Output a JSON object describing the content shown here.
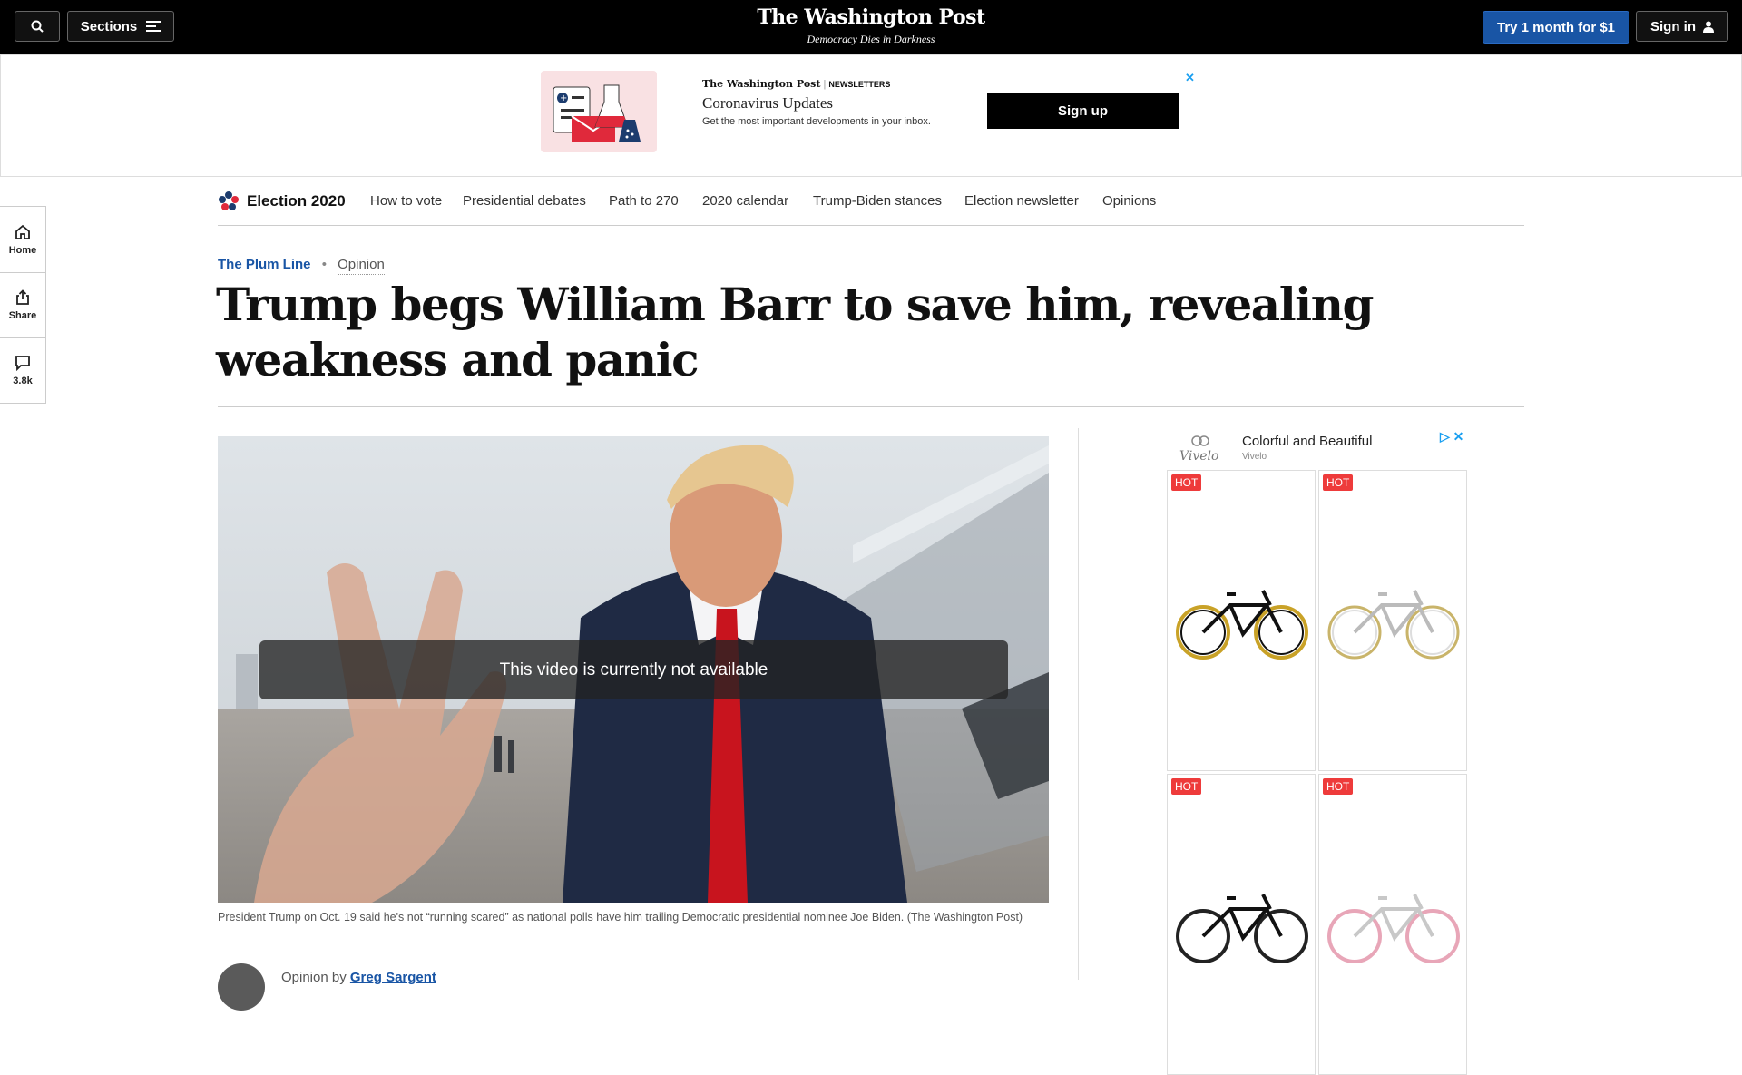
{
  "header": {
    "sections_label": "Sections",
    "logo": "The Washington Post",
    "tagline": "Democracy Dies in Darkness",
    "try_label": "Try 1 month for $1",
    "signin_label": "Sign in"
  },
  "newsletter_ad": {
    "brand": "The Washington Post",
    "brand_suffix": "NEWSLETTERS",
    "title": "Coronavirus Updates",
    "description": "Get the most important developments in your inbox.",
    "cta": "Sign up",
    "close": "✕"
  },
  "election_nav": {
    "title": "Election 2020",
    "items": [
      "How to vote",
      "Presidential debates",
      "Path to 270",
      "2020 calendar",
      "Trump-Biden stances",
      "Election newsletter",
      "Opinions"
    ]
  },
  "rail": {
    "home": "Home",
    "share": "Share",
    "comments": "3.8k"
  },
  "article": {
    "section": "The Plum Line",
    "label": "Opinion",
    "headline": "Trump begs William Barr to save him, revealing weakness and panic",
    "video_message": "This video is currently not available",
    "caption": "President Trump on Oct. 19 said he's not “running scared” as national polls have him trailing Democratic presidential nominee Joe Biden. (The Washington Post)",
    "byline_prefix": "Opinion by",
    "author": "Greg Sargent"
  },
  "side_ad": {
    "logo": "Vivelo",
    "title": "Colorful and Beautiful",
    "sponsor": "Vivelo",
    "badge": "HOT",
    "icons": "▷ ✕"
  },
  "colors": {
    "topbar": "#000000",
    "accent_blue": "#1955a5",
    "hot_badge": "#ee3b3b"
  }
}
